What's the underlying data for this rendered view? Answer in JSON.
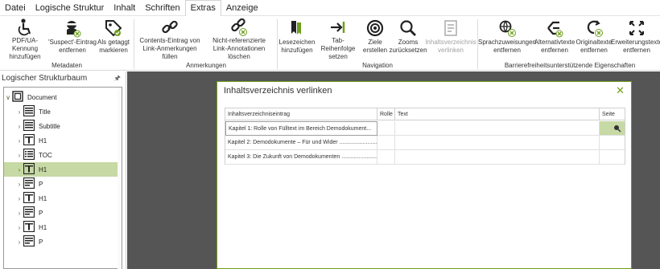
{
  "menubar": {
    "items": [
      {
        "label": "Datei"
      },
      {
        "label": "Logische Struktur"
      },
      {
        "label": "Inhalt"
      },
      {
        "label": "Schriften"
      },
      {
        "label": "Extras"
      },
      {
        "label": "Anzeige"
      }
    ],
    "active": "Extras"
  },
  "ribbon": {
    "buttons": [
      {
        "label": "PDF/UA-Kennung\nhinzufügen",
        "icon": "accessibility-icon"
      },
      {
        "label": "'Suspect'-Eintrag\nentfernen",
        "icon": "suspect-remove-icon"
      },
      {
        "label": "Als getaggt\nmarkieren",
        "icon": "tag-icon"
      },
      {
        "label": "Contents-Eintrag von\nLink-Anmerkungen füllen",
        "icon": "link-icon"
      },
      {
        "label": "Nicht-referenzierte\nLink-Annotationen löschen",
        "icon": "link-delete-icon"
      },
      {
        "label": "Lesezeichen\nhinzufügen",
        "icon": "bookmark-icon"
      },
      {
        "label": "Tab-Reihenfolge\nsetzen",
        "icon": "tab-order-icon"
      },
      {
        "label": "Ziele\nerstellen",
        "icon": "target-icon"
      },
      {
        "label": "Zooms\nzurücksetzen",
        "icon": "zoom-icon"
      },
      {
        "label": "Inhaltsverzeichnis\nverlinken",
        "icon": "toc-icon"
      },
      {
        "label": "Sprachzuweisungen\nentfernen",
        "icon": "language-icon"
      },
      {
        "label": "Alternativtexte\nentfernen",
        "icon": "alt-text-icon"
      },
      {
        "label": "Originaltexte\nentfernen",
        "icon": "original-text-icon"
      },
      {
        "label": "Erweiterungstexte\nentfernen",
        "icon": "expansion-text-icon"
      }
    ],
    "groups": [
      {
        "label": "Metadaten"
      },
      {
        "label": "Anmerkungen"
      },
      {
        "label": "Navigation"
      },
      {
        "label": "Barrierefreiheitsunterstützende Eigenschaften"
      }
    ]
  },
  "panel": {
    "title": "Logischer Strukturbaum",
    "tree": [
      {
        "label": "Document",
        "level": 0,
        "expanded": true,
        "selected": false
      },
      {
        "label": "Title",
        "level": 1,
        "selected": false
      },
      {
        "label": "Subtitle",
        "level": 1,
        "selected": false
      },
      {
        "label": "H1",
        "level": 1,
        "selected": false
      },
      {
        "label": "TOC",
        "level": 1,
        "selected": false
      },
      {
        "label": "H1",
        "level": 1,
        "selected": true
      },
      {
        "label": "P",
        "level": 1,
        "selected": false
      },
      {
        "label": "H1",
        "level": 1,
        "selected": false
      },
      {
        "label": "P",
        "level": 1,
        "selected": false
      },
      {
        "label": "H1",
        "level": 1,
        "selected": false
      },
      {
        "label": "P",
        "level": 1,
        "selected": false
      }
    ]
  },
  "dialog": {
    "title": "Inhaltsverzeichnis verlinken",
    "columns": [
      {
        "label": "Inhaltsverzeichniseintrag"
      },
      {
        "label": "Rolle"
      },
      {
        "label": "Text"
      },
      {
        "label": "Seite"
      }
    ],
    "rows": [
      {
        "entry": "Kapitel 1: Rolle von Fülltext im Bereich Demodokument...",
        "role": "",
        "text": "",
        "page": ""
      },
      {
        "entry": "Kapitel 2: Demodokumente – Für und Wider ........................",
        "role": "",
        "text": "",
        "page": ""
      },
      {
        "entry": "Kapitel 3: Die Zukunft von Demodokumenten ........................",
        "role": "",
        "text": "",
        "page": ""
      }
    ]
  },
  "colors": {
    "accent": "#6e9e1b",
    "selection": "#c7d9a4",
    "dark_area": "#555555"
  }
}
